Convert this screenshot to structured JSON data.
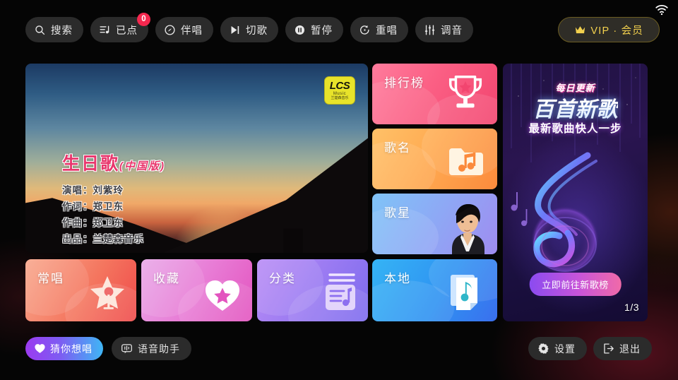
{
  "status": {
    "wifi_icon": "wifi-icon"
  },
  "toolbar": {
    "buttons": [
      {
        "label": "搜索",
        "icon": "search-icon"
      },
      {
        "label": "已点",
        "icon": "playlist-icon",
        "badge": "0"
      },
      {
        "label": "伴唱",
        "icon": "disc-icon"
      },
      {
        "label": "切歌",
        "icon": "skip-next-icon"
      },
      {
        "label": "暂停",
        "icon": "pause-icon"
      },
      {
        "label": "重唱",
        "icon": "replay-icon"
      },
      {
        "label": "调音",
        "icon": "equalizer-icon"
      }
    ],
    "vip": {
      "label": "VIP · 会员",
      "icon": "crown-icon",
      "color": "#f3d14e"
    }
  },
  "video": {
    "title": "生日歌",
    "title_sub": "(中国版)",
    "credits": [
      "演唱：刘紫玲",
      "作词：郑卫东",
      "作曲：郑卫东",
      "出品：兰楚森音乐"
    ],
    "logo": {
      "line1": "LCS",
      "line2": "Music",
      "line3": "兰楚森音乐"
    }
  },
  "tiles": {
    "rank": {
      "label": "排行榜",
      "icon": "trophy-icon",
      "color": "#f2456f"
    },
    "name": {
      "label": "歌名",
      "icon": "music-folder-icon",
      "color": "#fb8a3c"
    },
    "star": {
      "label": "歌星",
      "icon": "singer-photo",
      "color": "#9f8cf0"
    },
    "often": {
      "label": "常唱",
      "icon": "star-mic-icon",
      "color": "#ef4a4a"
    },
    "fav": {
      "label": "收藏",
      "icon": "heart-star-icon",
      "color": "#e354bf"
    },
    "cat": {
      "label": "分类",
      "icon": "category-list-icon",
      "color": "#7d6bee"
    },
    "local": {
      "label": "本地",
      "icon": "local-music-icon",
      "color": "#3a6fee"
    }
  },
  "promo": {
    "tag": "每日更新",
    "headline": "百首新歌",
    "subline": "最新歌曲快人一步",
    "cta": "立即前往新歌榜",
    "page": "1/3"
  },
  "bottombar": {
    "guess": {
      "label": "猜你想唱",
      "icon": "heart-icon"
    },
    "voice": {
      "label": "语音助手",
      "icon": "speech-bubble-icon"
    },
    "settings": {
      "label": "设置",
      "icon": "gear-icon"
    },
    "exit": {
      "label": "退出",
      "icon": "exit-icon"
    }
  }
}
